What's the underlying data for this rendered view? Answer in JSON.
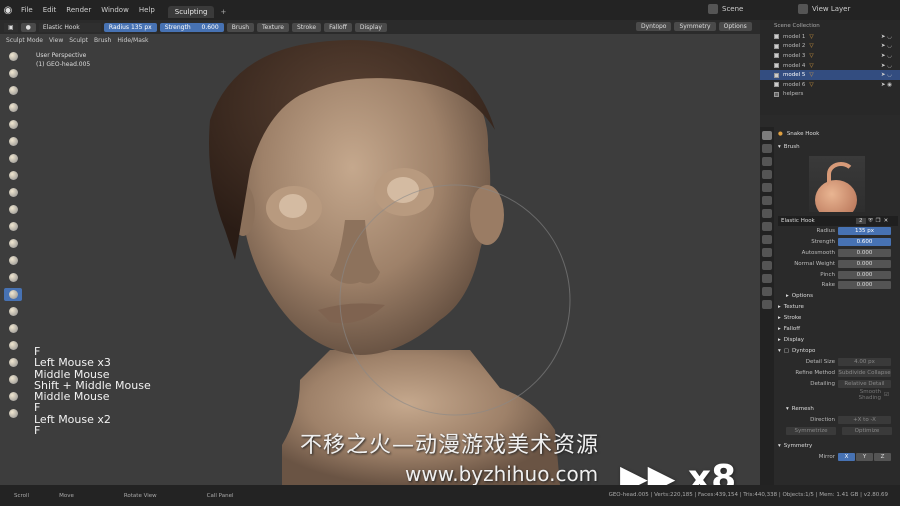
{
  "topbar": {
    "menus": [
      "File",
      "Edit",
      "Render",
      "Window",
      "Help"
    ],
    "active_tab": "Sculpting",
    "tab_plus": "+",
    "scene": "Scene",
    "view_layer": "View Layer"
  },
  "header": {
    "brush_name": "Elastic Hook",
    "radius_label": "Radius",
    "radius_value": "135 px",
    "strength_label": "Strength",
    "strength_value": "0.600",
    "menus": [
      "Brush",
      "Texture",
      "Stroke",
      "Falloff",
      "Display"
    ],
    "right_menus": [
      "Dyntopo",
      "Symmetry",
      "Options"
    ]
  },
  "header2": {
    "mode": "Sculpt Mode",
    "items": [
      "View",
      "Sculpt",
      "Brush",
      "Hide/Mask"
    ]
  },
  "viewport": {
    "perspective": "User Perspective",
    "object": "(1) GEO-head.005",
    "keys": [
      "F",
      "Left Mouse x3",
      "Middle Mouse",
      "Shift + Middle Mouse",
      "Middle Mouse",
      "F",
      "Left Mouse x2",
      "F"
    ],
    "watermark_cn": "不移之火—动漫游戏美术资源",
    "watermark_url": "www.byzhihuo.com",
    "speed": "▶▶ x8"
  },
  "outliner": {
    "collection": "Scene Collection",
    "items": [
      "model 1",
      "model 2",
      "model 3",
      "model 4",
      "model 5",
      "model 6",
      "helpers"
    ]
  },
  "properties": {
    "brush_header": "Snake Hook",
    "brush_section": "Brush",
    "brush_name": "Elastic Hook",
    "brush_users": "2",
    "rows": [
      {
        "label": "Radius",
        "value": "135 px"
      },
      {
        "label": "Strength",
        "value": "0.600"
      },
      {
        "label": "Autosmooth",
        "value": "0.000"
      },
      {
        "label": "Normal Weight",
        "value": "0.000"
      },
      {
        "label": "Pinch",
        "value": "0.000"
      },
      {
        "label": "Rake",
        "value": "0.000"
      }
    ],
    "options": "Options",
    "sections": [
      "Texture",
      "Stroke",
      "Falloff",
      "Display"
    ],
    "dyntopo": "Dyntopo",
    "dyn_rows": [
      {
        "label": "Detail Size",
        "value": "4.00 px"
      },
      {
        "label": "Refine Method",
        "value": "Subdivide Collapse"
      },
      {
        "label": "Detailing",
        "value": "Relative Detail"
      }
    ],
    "smooth_shading": "Smooth Shading",
    "remesh": "Remesh",
    "direction_label": "Direction",
    "direction_value": "+X to -X",
    "symmetrize": "Symmetrize",
    "optimize": "Optimize",
    "symmetry": "Symmetry",
    "mirror": "Mirror",
    "axes": [
      "X",
      "Y",
      "Z"
    ]
  },
  "status": {
    "items": [
      "Scroll",
      "Move",
      "Rotate View",
      "Call Panel"
    ],
    "stats": "GEO-head.005 | Verts:220,185 | Faces:439,154 | Tris:440,338 | Objects:1/5 | Mem: 1.41 GB | v2.80.69"
  }
}
